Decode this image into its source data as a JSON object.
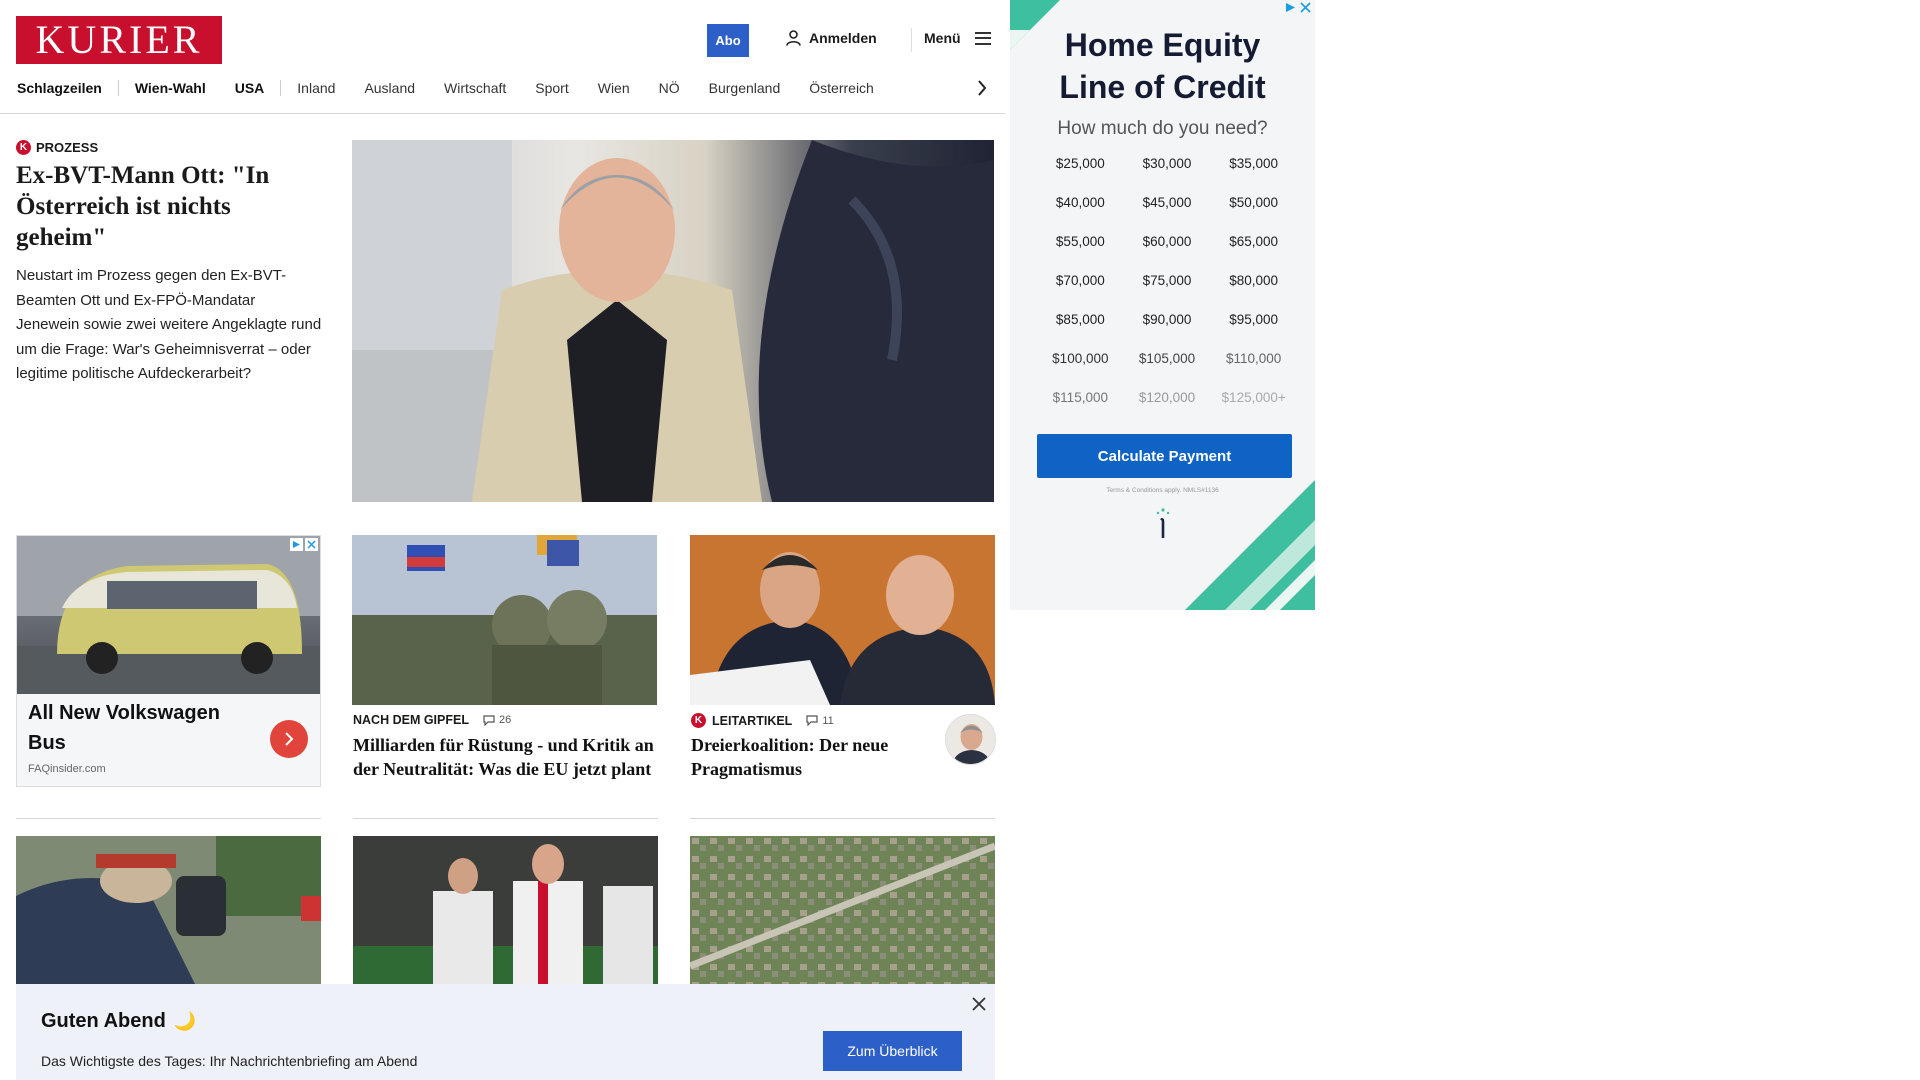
{
  "header": {
    "logo_text": "KURIER",
    "abo_label": "Abo",
    "login_label": "Anmelden",
    "menu_label": "Menü"
  },
  "nav": {
    "items": [
      "Schlagzeilen",
      "Wien-Wahl",
      "USA",
      "Inland",
      "Ausland",
      "Wirtschaft",
      "Sport",
      "Wien",
      "NÖ",
      "Burgenland",
      "Österreich"
    ]
  },
  "lead": {
    "kicker": "PROZESS",
    "kicker_badge": "K",
    "title": "Ex-BVT-Mann Ott: \"In Österreich ist nichts geheim\"",
    "text": "Neustart im Prozess gegen den Ex-BVT-Beamten Ott und Ex-FPÖ-Mandatar Jenewein sowie zwei weitere Angeklagte rund um die Frage: War's Geheimnisverrat – oder legitime politische Aufdeckerarbeit?"
  },
  "ad_card": {
    "title": "All New Volkswagen Bus",
    "source": "FAQinsider.com"
  },
  "teasers": [
    {
      "kicker": "NACH DEM GIPFEL",
      "comments": "26",
      "title": "Milliarden für Rüstung - und Kritik an der Neutralität: Was die EU jetzt plant"
    },
    {
      "kicker": "LEITARTIKEL",
      "kicker_badge": "K",
      "comments": "11",
      "title": "Dreierkoalition: Der neue Pragmatismus"
    }
  ],
  "banner": {
    "title": "Guten Abend",
    "title_icon": "🌙",
    "text": "Das Wichtigste des Tages: Ihr Nachrichtenbriefing am Abend",
    "button": "Zum Überblick"
  },
  "ad_right": {
    "title_line1": "Home Equity",
    "title_line2": "Line of Credit",
    "subtitle": "How much do you need?",
    "amounts": [
      "$25,000",
      "$30,000",
      "$35,000",
      "$40,000",
      "$45,000",
      "$50,000",
      "$55,000",
      "$60,000",
      "$65,000",
      "$70,000",
      "$75,000",
      "$80,000",
      "$85,000",
      "$90,000",
      "$95,000",
      "$100,000",
      "$105,000",
      "$110,000",
      "$115,000",
      "$120,000",
      "$125,000+"
    ],
    "button": "Calculate Payment",
    "terms": "Terms & Conditions apply. NMLS#1136"
  },
  "colors": {
    "brand_red": "#c8102e",
    "accent_blue": "#2d5fc9",
    "ad_blue": "#0f63c4",
    "ad_teal": "#3dbfa0"
  }
}
